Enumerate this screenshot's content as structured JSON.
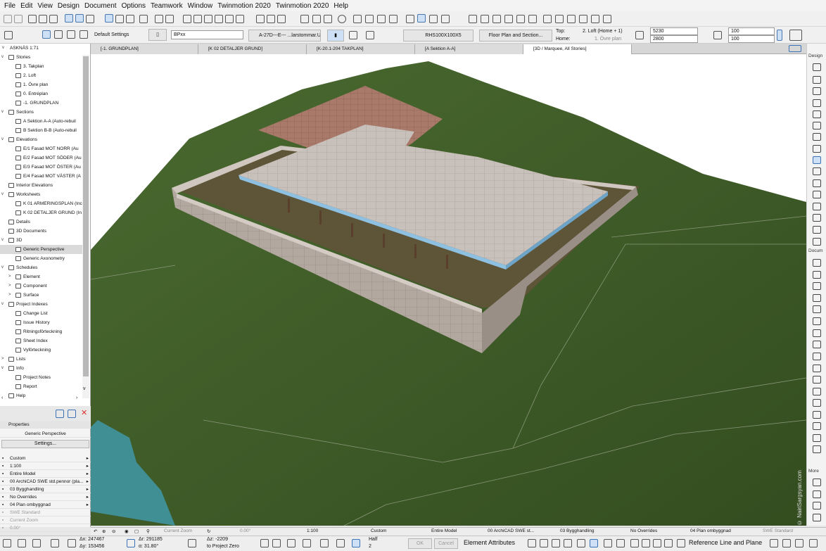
{
  "menu": [
    "File",
    "Edit",
    "View",
    "Design",
    "Document",
    "Options",
    "Teamwork",
    "Window",
    "Twinmotion 2020",
    "Twinmotion 2020",
    "Help"
  ],
  "toolbar2": {
    "default_settings": "Default Settings",
    "id_field": "BPxx",
    "layer_field": "A-27D---E--- ...larstommar.U",
    "composite": "RHS100X100X5",
    "floor_plan_btn": "Floor Plan and Section...",
    "top_label": "Top:",
    "top_value": "2. Loft (Home + 1)",
    "home_label": "Home:",
    "home_value": "1. Övre plan",
    "height_top": "5230",
    "height_bottom": "2800",
    "width_top": "100",
    "width_bottom": "100"
  },
  "tabs": [
    "[-1. GRUNDPLAN]",
    "[K 02 DETALJER GRUND]",
    "[K-20.1-204 TAKPLAN]",
    "[A Sektion A-A]",
    "[3D / Marquee, All Stories]"
  ],
  "navigator": {
    "root": "ASKNÄS 1:71",
    "items": [
      {
        "label": "Stories",
        "lvl": 1,
        "tg": "v"
      },
      {
        "label": "3. Takplan",
        "lvl": 2
      },
      {
        "label": "2. Loft",
        "lvl": 2
      },
      {
        "label": "1. Övre plan",
        "lvl": 2
      },
      {
        "label": "0. Entréplan",
        "lvl": 2
      },
      {
        "label": "-1. GRUNDPLAN",
        "lvl": 2
      },
      {
        "label": "Sections",
        "lvl": 1,
        "tg": "v"
      },
      {
        "label": "A Sektion A-A (Auto-rebuil",
        "lvl": 2
      },
      {
        "label": "B Sektion B-B (Auto-rebuil",
        "lvl": 2
      },
      {
        "label": "Elevations",
        "lvl": 1,
        "tg": "v"
      },
      {
        "label": "E/1 Fasad MOT NORR (Au",
        "lvl": 2
      },
      {
        "label": "E/2 Fasad MOT SÖDER (Au",
        "lvl": 2
      },
      {
        "label": "E/3 Fasad MOT ÖSTER (Au",
        "lvl": 2
      },
      {
        "label": "E/4 Fasad MOT VÄSTER (A",
        "lvl": 2
      },
      {
        "label": "Interior Elevations",
        "lvl": 1
      },
      {
        "label": "Worksheets",
        "lvl": 1,
        "tg": "v"
      },
      {
        "label": "K 01 ARMERINGSPLAN (Inc",
        "lvl": 2
      },
      {
        "label": "K 02 DETALJER GRUND (In",
        "lvl": 2
      },
      {
        "label": "Details",
        "lvl": 1
      },
      {
        "label": "3D Documents",
        "lvl": 1
      },
      {
        "label": "3D",
        "lvl": 1,
        "tg": "v"
      },
      {
        "label": "Generic Perspective",
        "lvl": 2,
        "sel": true
      },
      {
        "label": "Generic Axonometry",
        "lvl": 2
      },
      {
        "label": "Schedules",
        "lvl": 1,
        "tg": "v"
      },
      {
        "label": "Element",
        "lvl": 2,
        "tg": ">"
      },
      {
        "label": "Component",
        "lvl": 2,
        "tg": ">"
      },
      {
        "label": "Surface",
        "lvl": 2,
        "tg": ">"
      },
      {
        "label": "Project Indexes",
        "lvl": 1,
        "tg": "v"
      },
      {
        "label": "Change List",
        "lvl": 2
      },
      {
        "label": "Issue History",
        "lvl": 2
      },
      {
        "label": "Ritningsförteckning",
        "lvl": 2
      },
      {
        "label": "Sheet Index",
        "lvl": 2
      },
      {
        "label": "Vyförteckning",
        "lvl": 2
      },
      {
        "label": "Lists",
        "lvl": 1,
        "tg": ">"
      },
      {
        "label": "Info",
        "lvl": 1,
        "tg": "v"
      },
      {
        "label": "Project Notes",
        "lvl": 2
      },
      {
        "label": "Report",
        "lvl": 2
      },
      {
        "label": "Help",
        "lvl": 1
      }
    ]
  },
  "properties": {
    "header": "Properties",
    "name": "Generic Perspective",
    "settings_btn": "Settings...",
    "rows": [
      "Custom",
      "1:100",
      "Entire Model",
      "00 ArchiCAD SWE std.pennor (pla...",
      "03 Bygghandling",
      "No Overrides",
      "04 Plan ombyggnad",
      "SWE Standard",
      "Current Zoom",
      "0.00°"
    ]
  },
  "right_toolbox": {
    "design_label": "Design",
    "docu_label": "Docum",
    "more_label": "More"
  },
  "watermark": "© NairiSargsyan.com",
  "status_bar": {
    "zoom": "Current Zoom",
    "angle": "0.00°",
    "scale": "1:100",
    "custom": "Custom",
    "model": "Entire Model",
    "pen": "00 ArchiCAD SWE st...",
    "bygg": "03 Bygghandling",
    "overrides": "No Overrides",
    "plan": "04 Plan ombyggnad",
    "standard": "SWE Standard"
  },
  "coords": {
    "ax": "Δx: 247467",
    "ay": "Δy: 153456",
    "ar": "Δr: 291185",
    "aa": "α: 31.80°",
    "az": "Δz: -2209",
    "ref": "to Project Zero",
    "half": "Half",
    "half_num": "2",
    "ok": "OK",
    "cancel": "Cancel",
    "elem_attr": "Element Attributes",
    "ref_line": "Reference Line and Plane"
  },
  "colors": {
    "grass": "#3f5a27",
    "wall": "#b7aca4",
    "roof": "#c9c2bb",
    "slab_edge": "#7bb0d8",
    "water": "#3f8f94"
  }
}
